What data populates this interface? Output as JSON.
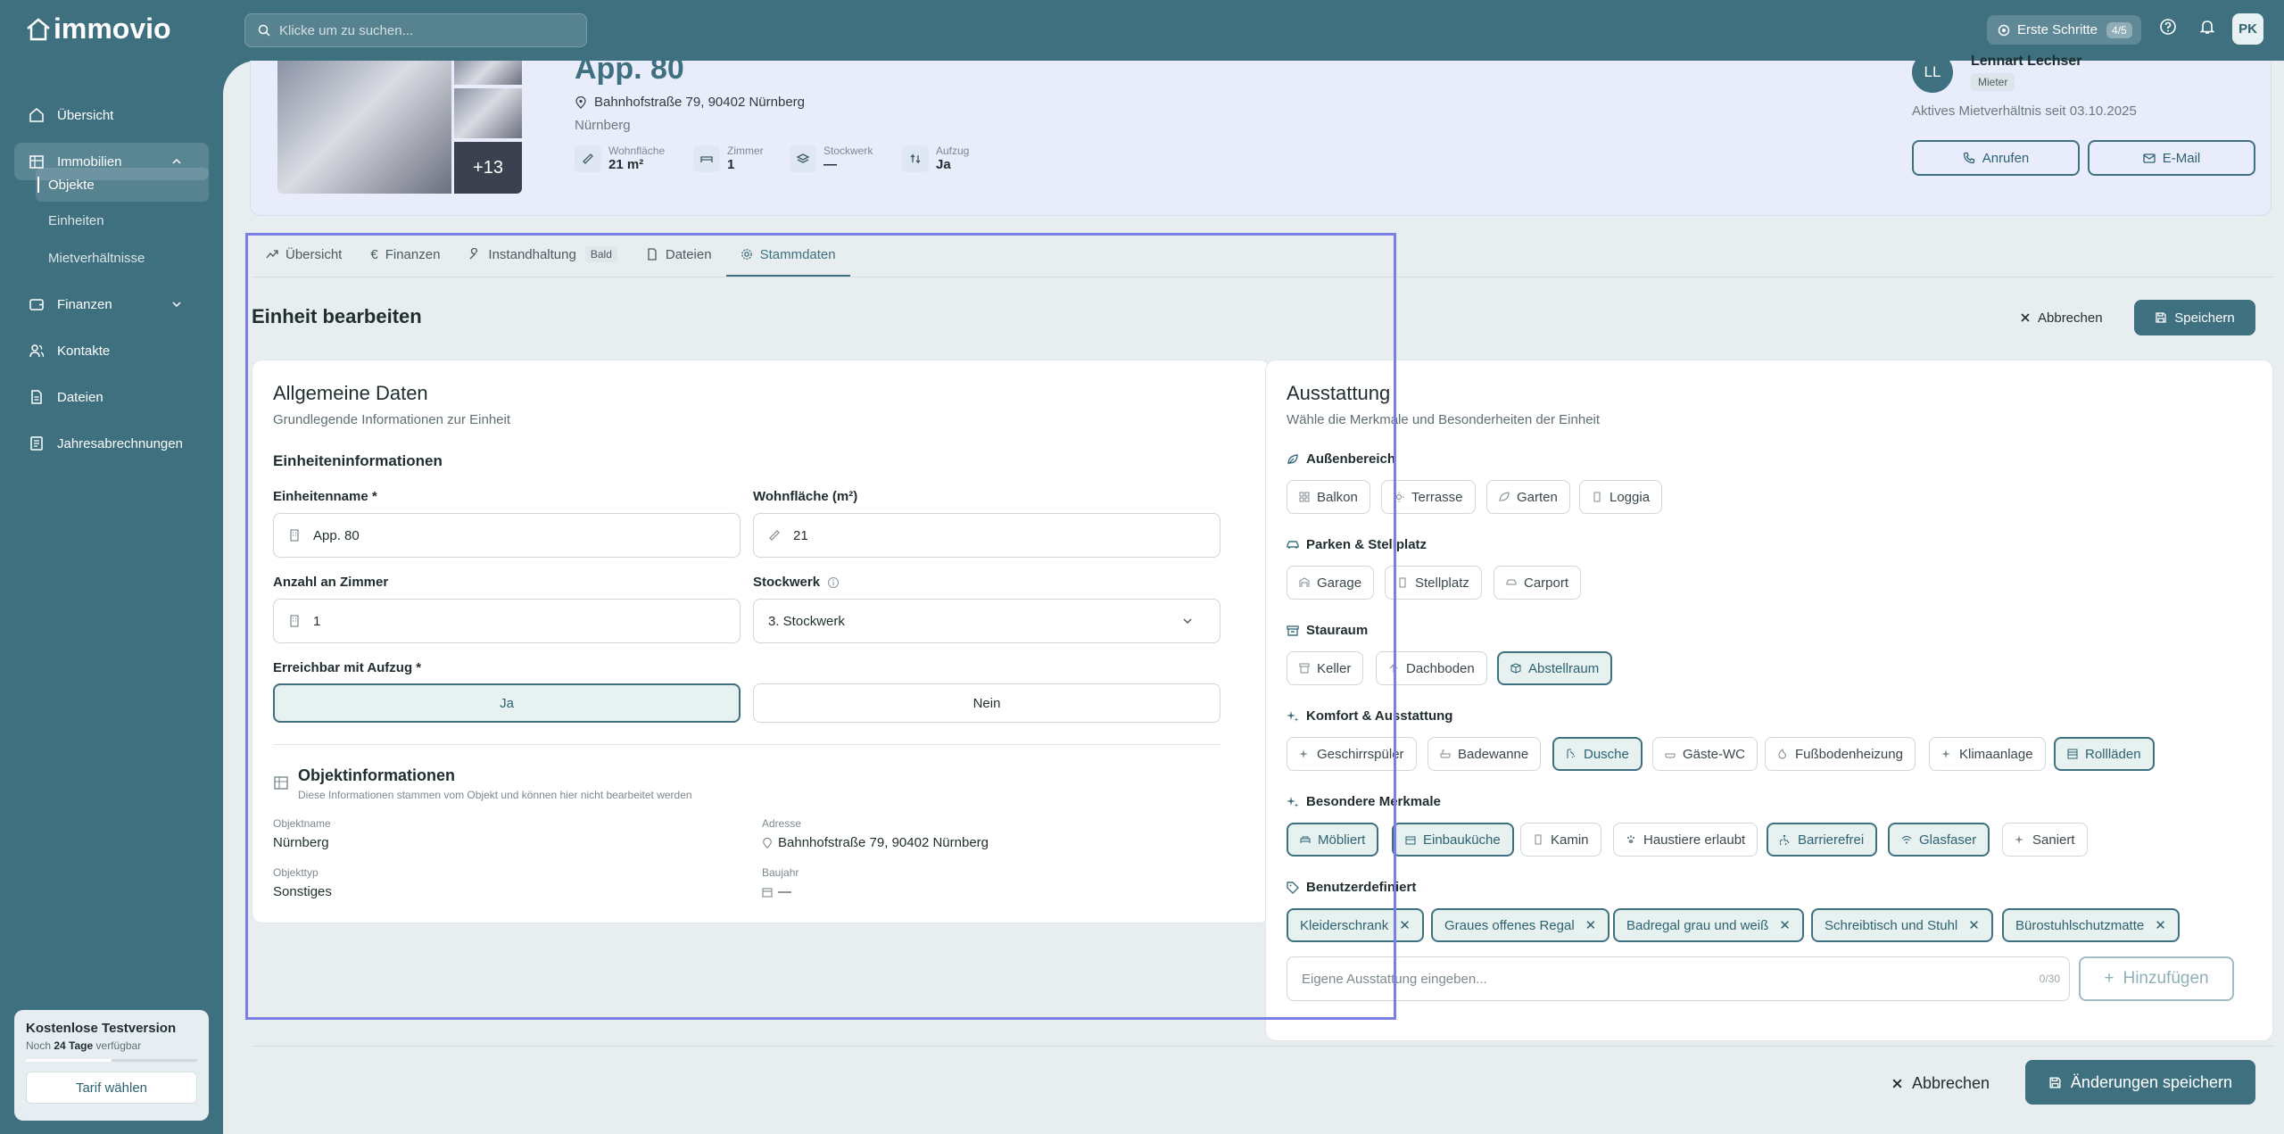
{
  "app": {
    "logo": "immovio"
  },
  "search": {
    "placeholder": "Klicke um zu suchen..."
  },
  "topbar": {
    "steps_label": "Erste Schritte",
    "steps_count": "4/5",
    "user_initials": "PK"
  },
  "sidebar": {
    "items": [
      {
        "label": "Übersicht",
        "icon": "home-icon"
      },
      {
        "label": "Immobilien",
        "icon": "building-icon"
      },
      {
        "label": "Finanzen",
        "icon": "wallet-icon"
      },
      {
        "label": "Kontakte",
        "icon": "users-icon"
      },
      {
        "label": "Dateien",
        "icon": "file-icon"
      },
      {
        "label": "Jahresabrechnungen",
        "icon": "receipt-icon"
      }
    ],
    "sub_items": [
      "Objekte",
      "Einheiten",
      "Mietverhältnisse"
    ]
  },
  "trial": {
    "title": "Kostenlose Testversion",
    "prefix": "Noch",
    "days": "24 Tage",
    "suffix": "verfügbar",
    "progress": 0.5,
    "button": "Tarif wählen"
  },
  "property": {
    "title": "App. 80",
    "address": "Bahnhofstraße 79, 90402 Nürnberg",
    "city": "Nürnberg",
    "more_photos": "+13",
    "stats": [
      {
        "label": "Wohnfläche",
        "value": "21 m²",
        "icon": "ruler-icon"
      },
      {
        "label": "Zimmer",
        "value": "1",
        "icon": "bed-icon"
      },
      {
        "label": "Stockwerk",
        "value": "—",
        "icon": "layers-icon"
      },
      {
        "label": "Aufzug",
        "value": "Ja",
        "icon": "elevator-icon"
      }
    ]
  },
  "tenant": {
    "initials": "LL",
    "name": "Lennart Lechser",
    "role": "Mieter",
    "since": "Aktives Mietverhältnis seit 03.10.2025",
    "call": "Anrufen",
    "email": "E-Mail"
  },
  "tabs": [
    {
      "label": "Übersicht",
      "icon": "trend-icon"
    },
    {
      "label": "Finanzen",
      "icon": "euro-icon"
    },
    {
      "label": "Instandhaltung",
      "icon": "wrench-icon",
      "badge": "Bald"
    },
    {
      "label": "Dateien",
      "icon": "file-icon"
    },
    {
      "label": "Stammdaten",
      "icon": "gear-icon"
    }
  ],
  "edit": {
    "title": "Einheit bearbeiten",
    "cancel": "Abbrechen",
    "save": "Speichern"
  },
  "general": {
    "title": "Allgemeine Daten",
    "desc": "Grundlegende Informationen zur Einheit",
    "section": "Einheiteninformationen",
    "name_label": "Einheitenname *",
    "name_value": "App. 80",
    "area_label": "Wohnfläche (m²)",
    "area_value": "21",
    "rooms_label": "Anzahl an Zimmer",
    "rooms_value": "1",
    "floor_label": "Stockwerk",
    "floor_value": "3. Stockwerk",
    "elevator_label": "Erreichbar mit Aufzug *",
    "yes": "Ja",
    "no": "Nein",
    "object_title": "Objektinformationen",
    "object_desc": "Diese Informationen stammen vom Objekt und können hier nicht bearbeitet werden",
    "meta": [
      {
        "label": "Objektname",
        "value": "Nürnberg"
      },
      {
        "label": "Adresse",
        "value": "Bahnhofstraße 79, 90402 Nürnberg"
      },
      {
        "label": "Objekttyp",
        "value": "Sonstiges"
      },
      {
        "label": "Baujahr",
        "value": "—"
      }
    ]
  },
  "features": {
    "title": "Ausstattung",
    "desc": "Wähle die Merkmale und Besonderheiten der Einheit",
    "categories": [
      {
        "name": "Außenbereich",
        "chips": [
          {
            "label": "Balkon",
            "on": false
          },
          {
            "label": "Terrasse",
            "on": false
          },
          {
            "label": "Garten",
            "on": false
          },
          {
            "label": "Loggia",
            "on": false
          }
        ]
      },
      {
        "name": "Parken & Stellplatz",
        "chips": [
          {
            "label": "Garage",
            "on": false
          },
          {
            "label": "Stellplatz",
            "on": false
          },
          {
            "label": "Carport",
            "on": false
          }
        ]
      },
      {
        "name": "Stauraum",
        "chips": [
          {
            "label": "Keller",
            "on": false
          },
          {
            "label": "Dachboden",
            "on": false
          },
          {
            "label": "Abstellraum",
            "on": true
          }
        ]
      },
      {
        "name": "Komfort & Ausstattung",
        "chips": [
          {
            "label": "Geschirrspüler",
            "on": false
          },
          {
            "label": "Badewanne",
            "on": false
          },
          {
            "label": "Dusche",
            "on": true
          },
          {
            "label": "Gäste-WC",
            "on": false
          },
          {
            "label": "Fußbodenheizung",
            "on": false
          },
          {
            "label": "Klimaanlage",
            "on": false
          },
          {
            "label": "Rollläden",
            "on": true
          }
        ]
      },
      {
        "name": "Besondere Merkmale",
        "chips": [
          {
            "label": "Möbliert",
            "on": true
          },
          {
            "label": "Einbauküche",
            "on": true
          },
          {
            "label": "Kamin",
            "on": false
          },
          {
            "label": "Haustiere erlaubt",
            "on": false
          },
          {
            "label": "Barrierefrei",
            "on": true
          },
          {
            "label": "Glasfaser",
            "on": true
          },
          {
            "label": "Saniert",
            "on": false
          }
        ]
      },
      {
        "name": "Benutzerdefiniert",
        "chips": [
          {
            "label": "Kleiderschrank",
            "on": true
          },
          {
            "label": "Graues offenes Regal",
            "on": true
          },
          {
            "label": "Badregal grau und weiß",
            "on": true
          },
          {
            "label": "Schreibtisch und Stuhl",
            "on": true
          },
          {
            "label": "Bürostuhlschutzmatte",
            "on": true
          }
        ]
      }
    ],
    "custom_placeholder": "Eigene Ausstattung eingeben...",
    "custom_counter": "0/30",
    "add": "Hinzufügen"
  },
  "footer": {
    "cancel": "Abbrechen",
    "save": "Änderungen speichern"
  }
}
